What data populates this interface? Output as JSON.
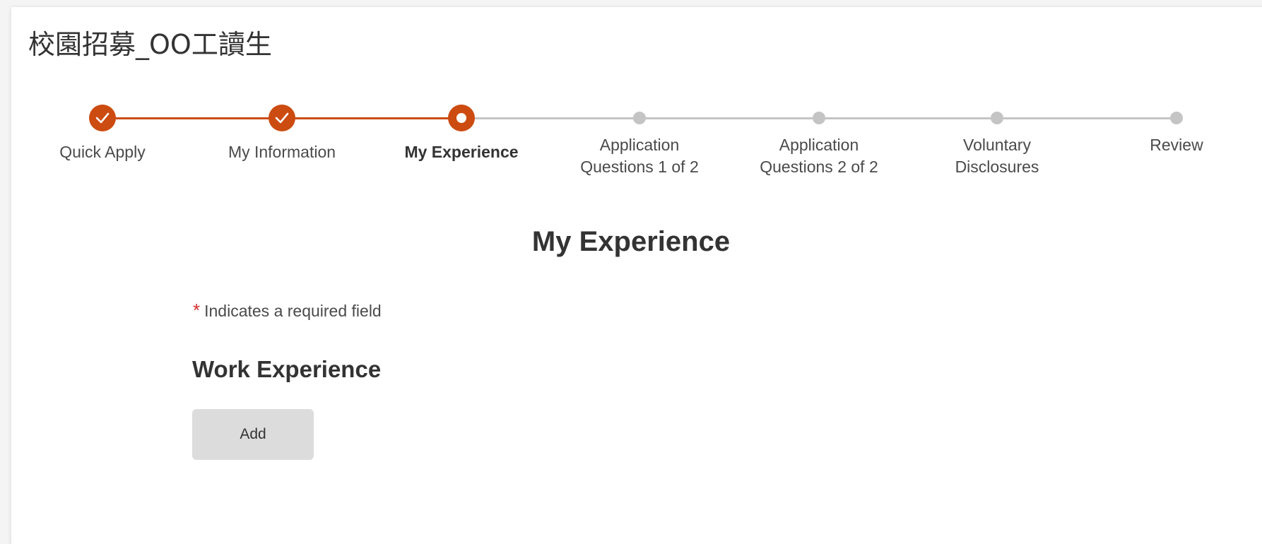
{
  "job_title": "校園招募_OO工讀生",
  "accent_color": "#cc4b10",
  "inactive_color": "#c4c4c4",
  "progress": {
    "current_step": 3,
    "total_steps": 7,
    "steps": [
      {
        "label": "Quick Apply",
        "status": "completed",
        "icon": "check-icon"
      },
      {
        "label": "My Information",
        "status": "completed",
        "icon": "check-icon"
      },
      {
        "label": "My Experience",
        "status": "current",
        "icon": "current-step-icon"
      },
      {
        "label": "Application\nQuestions 1 of 2",
        "status": "upcoming",
        "icon": "dot-icon"
      },
      {
        "label": "Application\nQuestions 2 of 2",
        "status": "upcoming",
        "icon": "dot-icon"
      },
      {
        "label": "Voluntary\nDisclosures",
        "status": "upcoming",
        "icon": "dot-icon"
      },
      {
        "label": "Review",
        "status": "upcoming",
        "icon": "dot-icon"
      }
    ]
  },
  "section": {
    "heading": "My Experience",
    "required_star": "*",
    "required_note": "Indicates a required field",
    "work_experience": {
      "heading": "Work Experience",
      "add_label": "Add"
    }
  }
}
